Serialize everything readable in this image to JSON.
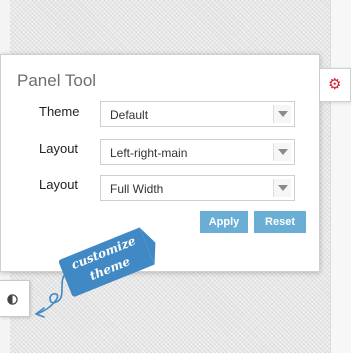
{
  "panel": {
    "title": "Panel Tool",
    "rows": [
      {
        "label": "Theme",
        "value": "Default"
      },
      {
        "label": "Layout",
        "value": "Left-right-main"
      },
      {
        "label": "Layout",
        "value": "Full Width"
      }
    ],
    "apply_label": "Apply",
    "reset_label": "Reset"
  },
  "ribbon": {
    "line1": "customize",
    "line2": "theme"
  },
  "icons": {
    "settings": "gear-icon",
    "toggle": "contrast-icon",
    "dropdown": "chevron-down-icon"
  },
  "colors": {
    "accent": "#6aaed6",
    "gear": "#d81e2a",
    "ribbon": "#4189c4"
  }
}
